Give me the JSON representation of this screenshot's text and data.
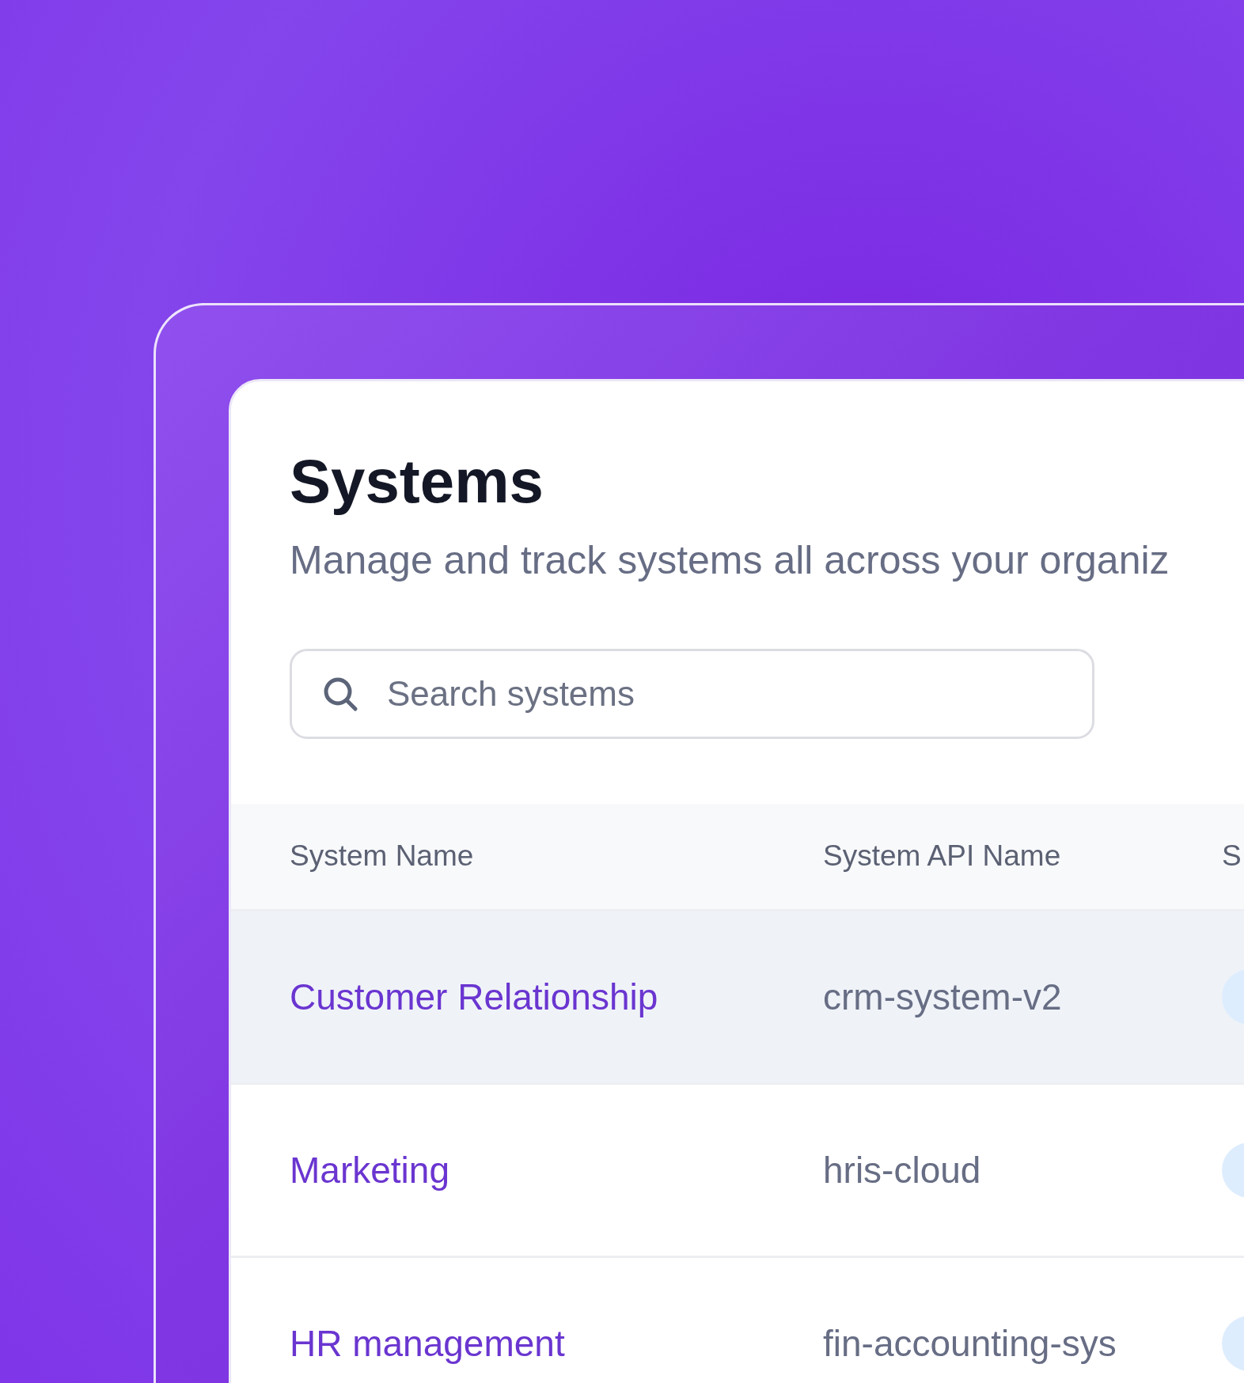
{
  "page": {
    "title": "Systems",
    "subtitle": "Manage and track systems all across your organiz"
  },
  "search": {
    "placeholder": "Search systems"
  },
  "table": {
    "columns": [
      "System Name",
      "System API Name",
      "S"
    ],
    "rows": [
      {
        "name": "Customer Relationship",
        "api_name": "crm-system-v2",
        "highlighted": true
      },
      {
        "name": "Marketing",
        "api_name": "hris-cloud",
        "highlighted": false
      },
      {
        "name": "HR management",
        "api_name": "fin-accounting-sys",
        "highlighted": false
      }
    ]
  }
}
